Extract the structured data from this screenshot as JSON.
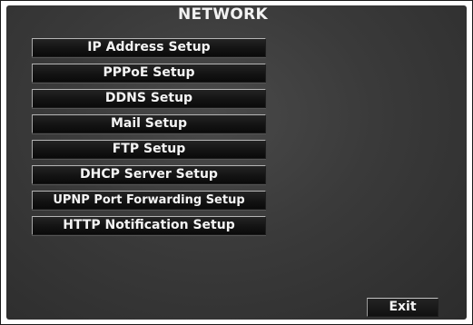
{
  "title": "NETWORK",
  "menu": {
    "items": [
      {
        "label": "IP Address Setup"
      },
      {
        "label": "PPPoE Setup"
      },
      {
        "label": "DDNS Setup"
      },
      {
        "label": "Mail Setup"
      },
      {
        "label": "FTP Setup"
      },
      {
        "label": "DHCP Server Setup"
      },
      {
        "label": "UPNP Port Forwarding Setup"
      },
      {
        "label": "HTTP Notification Setup"
      }
    ]
  },
  "footer": {
    "exit_label": "Exit"
  },
  "colors": {
    "screen_background": "#3a3a3a",
    "button_background": "#121212",
    "text": "#f4f4f4"
  }
}
